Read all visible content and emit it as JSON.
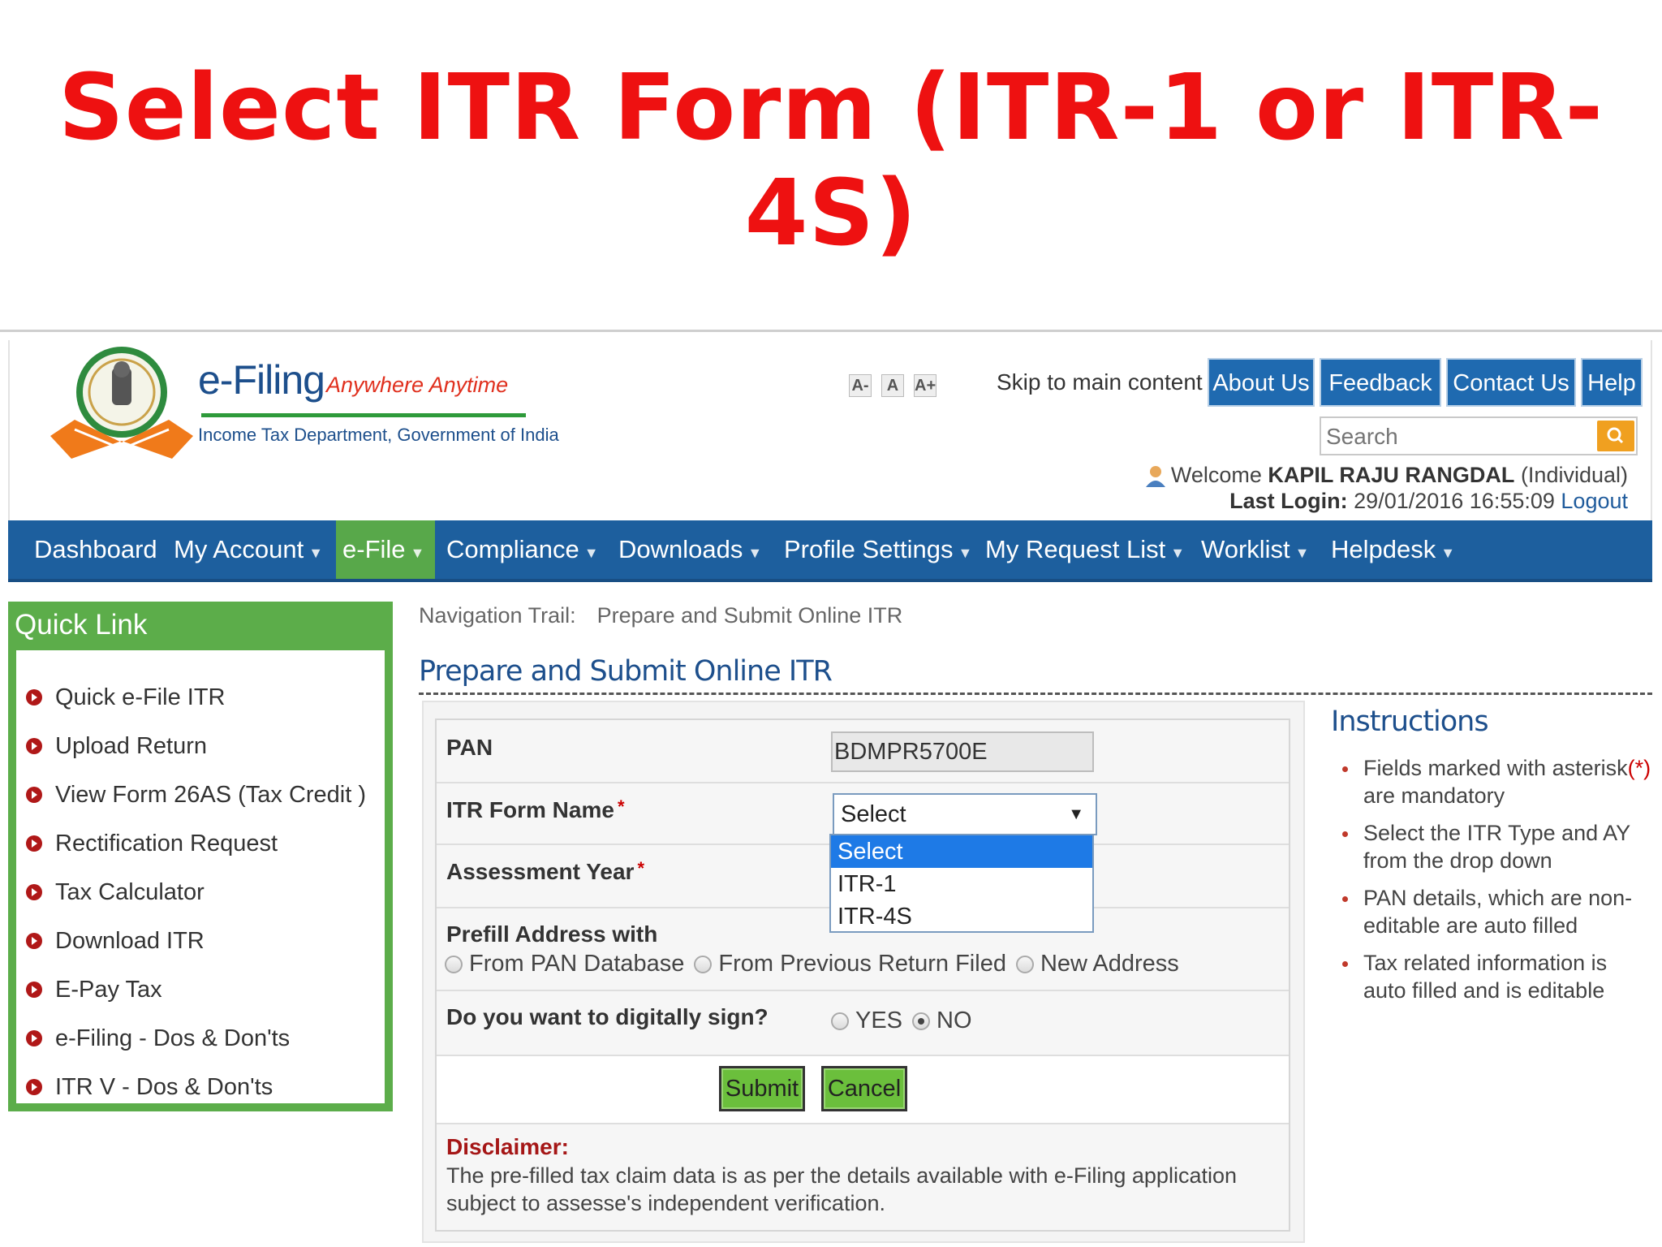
{
  "slide": {
    "title": "Select ITR Form (ITR-1 or ITR-4S)"
  },
  "header": {
    "brand": "e-Filing",
    "tagline": "Anywhere Anytime",
    "subtitle": "Income Tax Department, Government of India",
    "font_sizes": [
      "A-",
      "A",
      "A+"
    ],
    "skip_link": "Skip to main content",
    "top_buttons": [
      "About Us",
      "Feedback",
      "Contact Us",
      "Help"
    ],
    "search_placeholder": "Search",
    "welcome_prefix": "Welcome",
    "user_name": "KAPIL RAJU RANGDAL",
    "user_type": "(Individual)",
    "last_login_label": "Last Login:",
    "last_login_value": "29/01/2016 16:55:09",
    "logout": "Logout"
  },
  "nav": {
    "items": [
      "Dashboard",
      "My Account",
      "e-File",
      "Compliance",
      "Downloads",
      "Profile Settings",
      "My Request List",
      "Worklist",
      "Helpdesk"
    ],
    "active": "e-File"
  },
  "quick_link": {
    "title": "Quick Link",
    "items": [
      "Quick e-File ITR",
      "Upload Return",
      "View Form 26AS (Tax Credit )",
      "Rectification Request",
      "Tax Calculator",
      "Download ITR",
      "E-Pay Tax",
      "e-Filing - Dos & Don'ts",
      "ITR V - Dos & Don'ts"
    ]
  },
  "trail": {
    "label": "Navigation Trail:",
    "page": "Prepare and Submit Online ITR"
  },
  "page_title": "Prepare and Submit Online ITR",
  "form": {
    "pan_label": "PAN",
    "pan_value": "BDMPR5700E",
    "itr_label": "ITR Form Name",
    "itr_selected": "Select",
    "itr_options": [
      "Select",
      "ITR-1",
      "ITR-4S"
    ],
    "ay_label": "Assessment Year",
    "required_mark": "*",
    "prefill_label": "Prefill Address with",
    "prefill_options": [
      "From PAN Database",
      "From Previous Return Filed",
      "New Address"
    ],
    "sign_label": "Do you want to digitally sign?",
    "sign_options": [
      "YES",
      "NO"
    ],
    "sign_selected": "NO",
    "submit": "Submit",
    "cancel": "Cancel",
    "disclaimer_title": "Disclaimer:",
    "disclaimer_text": "The pre-filled tax claim data is as per the details available with e-Filing application subject to assesse's independent verification."
  },
  "instructions": {
    "title": "Instructions",
    "item1_text": "Fields marked with asterisk",
    "item1_mark": "(*)",
    "item1_tail": "are mandatory",
    "items": [
      "Select the ITR Type and AY from the drop down",
      "PAN details, which are non-editable are auto filled",
      "Tax related information is auto filled and is editable"
    ]
  },
  "colors": {
    "title_red": "#ee1111",
    "nav_blue": "#1d5f9e",
    "green": "#5cad4a",
    "select_blue": "#1e7ae6"
  }
}
